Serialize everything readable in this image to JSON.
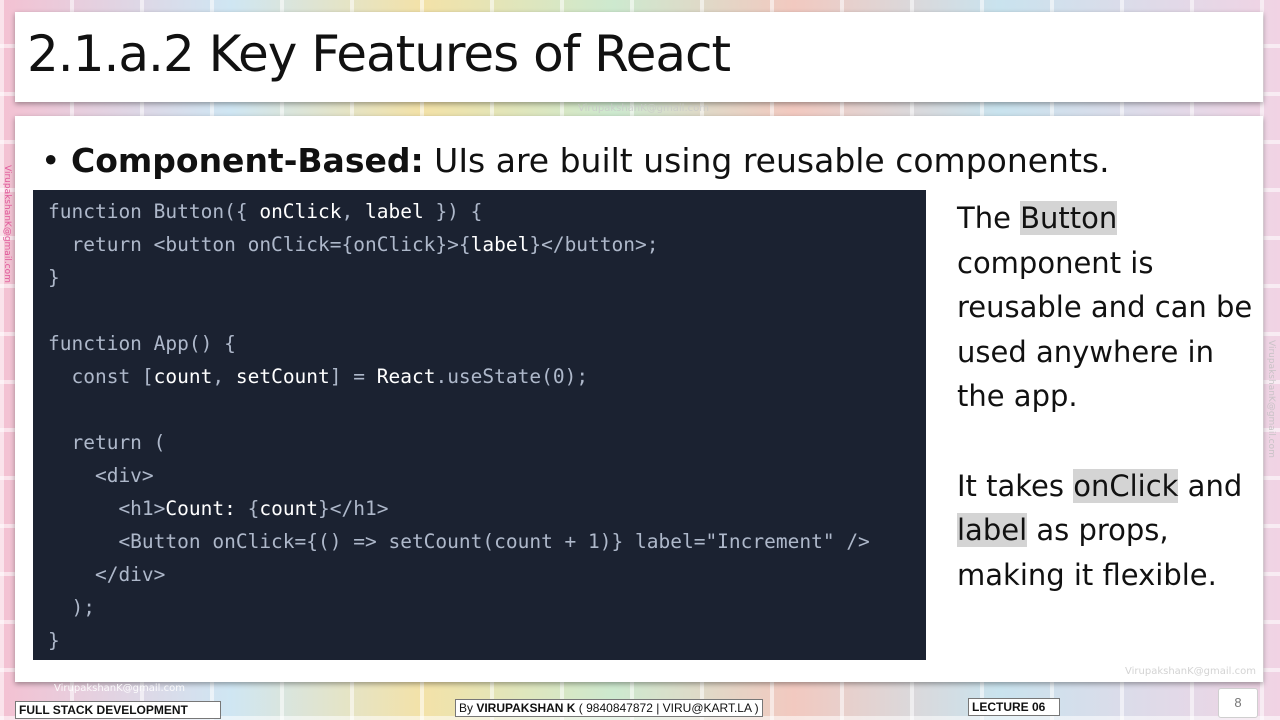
{
  "slide": {
    "title": "2.1.a.2 Key Features of React",
    "bullet": {
      "marker": "•",
      "heading": "Component-Based:",
      "text": " UIs are built using reusable components."
    },
    "code_lines": [
      [
        {
          "t": "function Button({ "
        },
        {
          "t": "onClick",
          "h": true
        },
        {
          "t": ", "
        },
        {
          "t": "label",
          "h": true
        },
        {
          "t": " }) {"
        }
      ],
      [
        {
          "t": "  return <button onClick={onClick}>{"
        },
        {
          "t": "label",
          "h": true
        },
        {
          "t": "}</button>;"
        }
      ],
      [
        {
          "t": "}"
        }
      ],
      [
        {
          "t": ""
        }
      ],
      [
        {
          "t": "function App() {"
        }
      ],
      [
        {
          "t": "  const ["
        },
        {
          "t": "count",
          "h": true
        },
        {
          "t": ", "
        },
        {
          "t": "setCount",
          "h": true
        },
        {
          "t": "] = "
        },
        {
          "t": "React",
          "h": true
        },
        {
          "t": ".useState(0);"
        }
      ],
      [
        {
          "t": ""
        }
      ],
      [
        {
          "t": "  return ("
        }
      ],
      [
        {
          "t": "    <div>"
        }
      ],
      [
        {
          "t": "      <h1>"
        },
        {
          "t": "Count:",
          "h": true
        },
        {
          "t": " {"
        },
        {
          "t": "count",
          "h": true
        },
        {
          "t": "}</h1>"
        }
      ],
      [
        {
          "t": "      <Button onClick={() => setCount(count + 1)} label=\"Increment\" />"
        }
      ],
      [
        {
          "t": "    </div>"
        }
      ],
      [
        {
          "t": "  );"
        }
      ],
      [
        {
          "t": "}"
        }
      ]
    ],
    "side_text": {
      "p1_a": "The ",
      "p1_mark": "Button",
      "p1_b": " component is reusable and can be used anywhere in the app.",
      "p2_a": "It takes ",
      "p2_mark1": "onClick",
      "p2_b": " and ",
      "p2_mark2": "label",
      "p2_c": " as props, making it flexible."
    }
  },
  "watermarks": {
    "email": "VirupakshanK@gmail.com"
  },
  "footer": {
    "course": "FULL STACK DEVELOPMENT",
    "author_prefix": "By ",
    "author_name": "VIRUPAKSHAN K",
    "author_suffix": " ( 9840847872 | VIRU@KART.LA )",
    "lecture": "LECTURE 06",
    "page_number": "8"
  },
  "colors": {
    "code_background": "#1b2231",
    "code_text": "#aeb8ca",
    "code_highlight": "#ffffff",
    "text_highlight": "#d4d4d4"
  }
}
